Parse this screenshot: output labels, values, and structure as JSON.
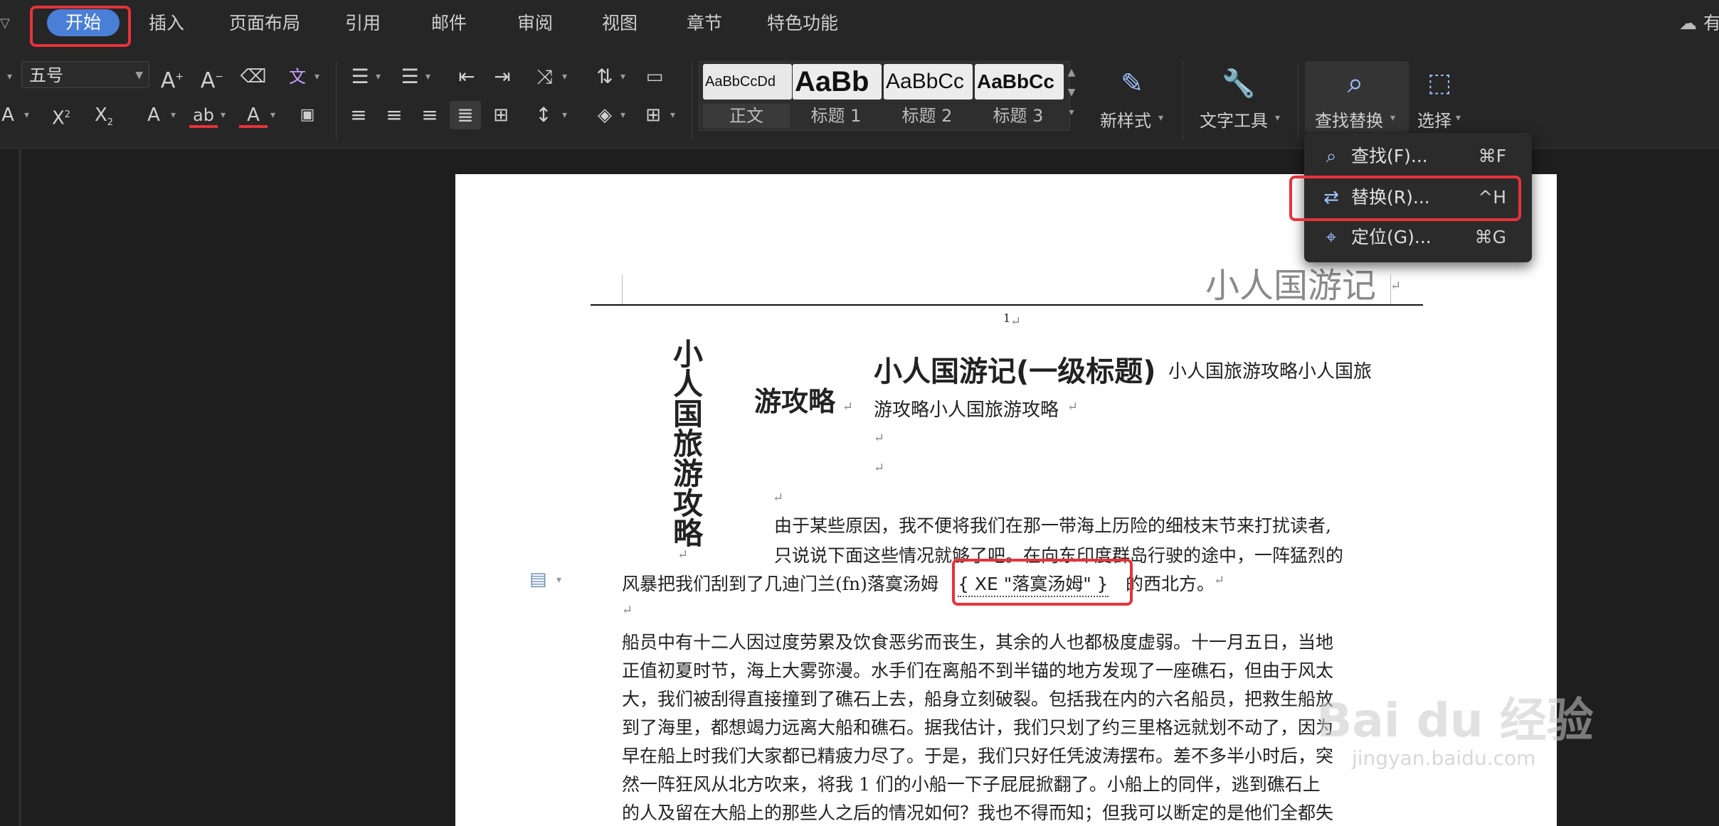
{
  "tabs": [
    "开始",
    "插入",
    "页面布局",
    "引用",
    "邮件",
    "审阅",
    "视图",
    "章节",
    "特色功能"
  ],
  "tab_right_label": "有",
  "font_size_value": "五号",
  "styles": [
    {
      "preview": "AaBbCcDd",
      "label": "正文"
    },
    {
      "preview": "AaBb",
      "label": "标题 1"
    },
    {
      "preview": "AaBbCc",
      "label": "标题 2"
    },
    {
      "preview": "AaBbCc",
      "label": "标题 3"
    }
  ],
  "ribbon_buttons": {
    "new_style": "新样式",
    "text_tools": "文字工具",
    "find_replace": "查找替换",
    "select": "选择"
  },
  "menu": [
    {
      "label": "查找(F)...",
      "shortcut": "⌘F",
      "icon": "search-icon"
    },
    {
      "label": "替换(R)...",
      "shortcut": "^H",
      "icon": "replace-icon"
    },
    {
      "label": "定位(G)...",
      "shortcut": "⌘G",
      "icon": "locate-icon"
    }
  ],
  "document": {
    "header_text": "小人国游记",
    "page_number": "1",
    "vertical_title": "小人国旅游攻略",
    "side_heading": "游攻略",
    "heading": "小人国游记(一级标题)",
    "heading_after": "小人国旅游攻略小人国旅",
    "line2": "游攻略小人国旅游攻略",
    "para1_l1": "由于某些原因，我不便将我们在那一带海上历险的细枝末节来打扰读者,",
    "para1_l2": "只说说下面这些情况就够了吧。在向东印度群岛行驶的途中，一阵猛烈的",
    "para1_l3a": "风暴把我们刮到了几迪门兰(fn)落寞汤姆",
    "xe_field": "{ XE \"落寞汤姆\" }",
    "para1_l3b": "的西北方。",
    "para2": [
      "船员中有十二人因过度劳累及饮食恶劣而丧生，其余的人也都极度虚弱。十一月五日，当地",
      "正值初夏时节，海上大雾弥漫。水手们在离船不到半锚的地方发现了一座礁石，但由于风太",
      "大，我们被刮得直接撞到了礁石上去，船身立刻破裂。包括我在内的六名船员，把救生船放",
      "到了海里，都想竭力远离大船和礁石。据我估计，我们只划了约三里格远就划不动了，因为",
      "早在船上时我们大家都已精疲力尽了。于是，我们只好任凭波涛摆布。差不多半小时后，突",
      "然一阵狂风从北方吹来，将我 1 们的小船一下子屁屁掀翻了。小船上的同伴，逃到礁石上",
      "的人及留在大船上的那些人之后的情况如何？我也不得而知；但我可以断定的是他们全都失"
    ]
  },
  "watermark": {
    "brand": "Bai du 经验",
    "url": "jingyan.baidu.com"
  },
  "colors": {
    "accent": "#4a7fd8",
    "highlight_box": "#e6333a",
    "toolbar_bg": "#262626",
    "page_bg": "#ffffff"
  }
}
